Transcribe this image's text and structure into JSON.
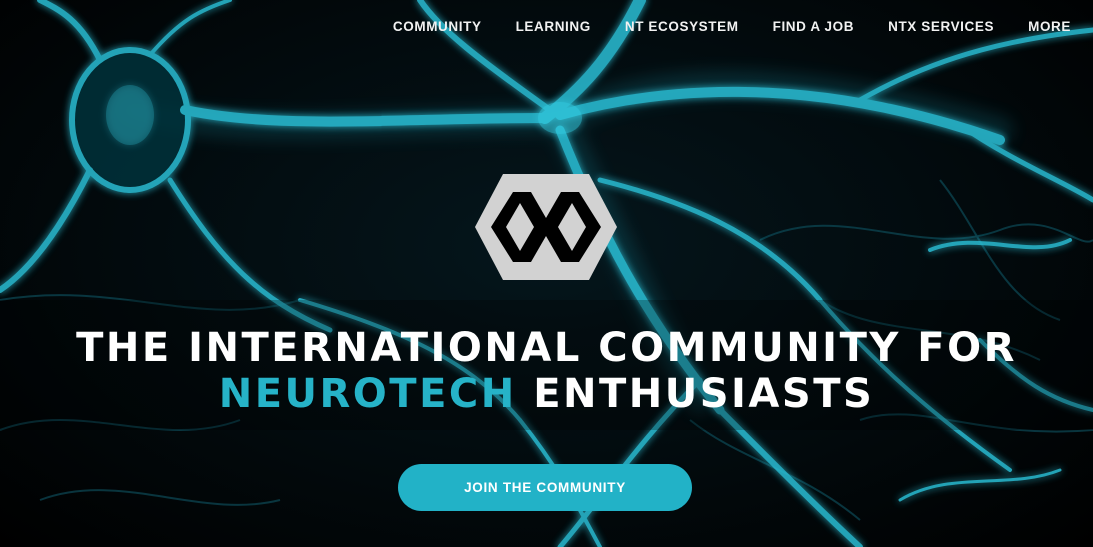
{
  "nav": {
    "items": [
      {
        "label": "COMMUNITY"
      },
      {
        "label": "LEARNING"
      },
      {
        "label": "NT ECOSYSTEM"
      },
      {
        "label": "FIND A JOB"
      },
      {
        "label": "NTX SERVICES"
      },
      {
        "label": "MORE"
      }
    ]
  },
  "hero": {
    "background": "neurons-image",
    "logo": "neurotechx-hexagon-logo",
    "headline_line1": "THE INTERNATIONAL COMMUNITY FOR",
    "headline_accent": "NEUROTECH",
    "headline_rest": "ENTHUSIASTS",
    "cta_label": "JOIN THE COMMUNITY"
  },
  "colors": {
    "accent": "#26b3c8",
    "button": "#22b2c7",
    "text": "#ffffff",
    "background": "#000000"
  }
}
